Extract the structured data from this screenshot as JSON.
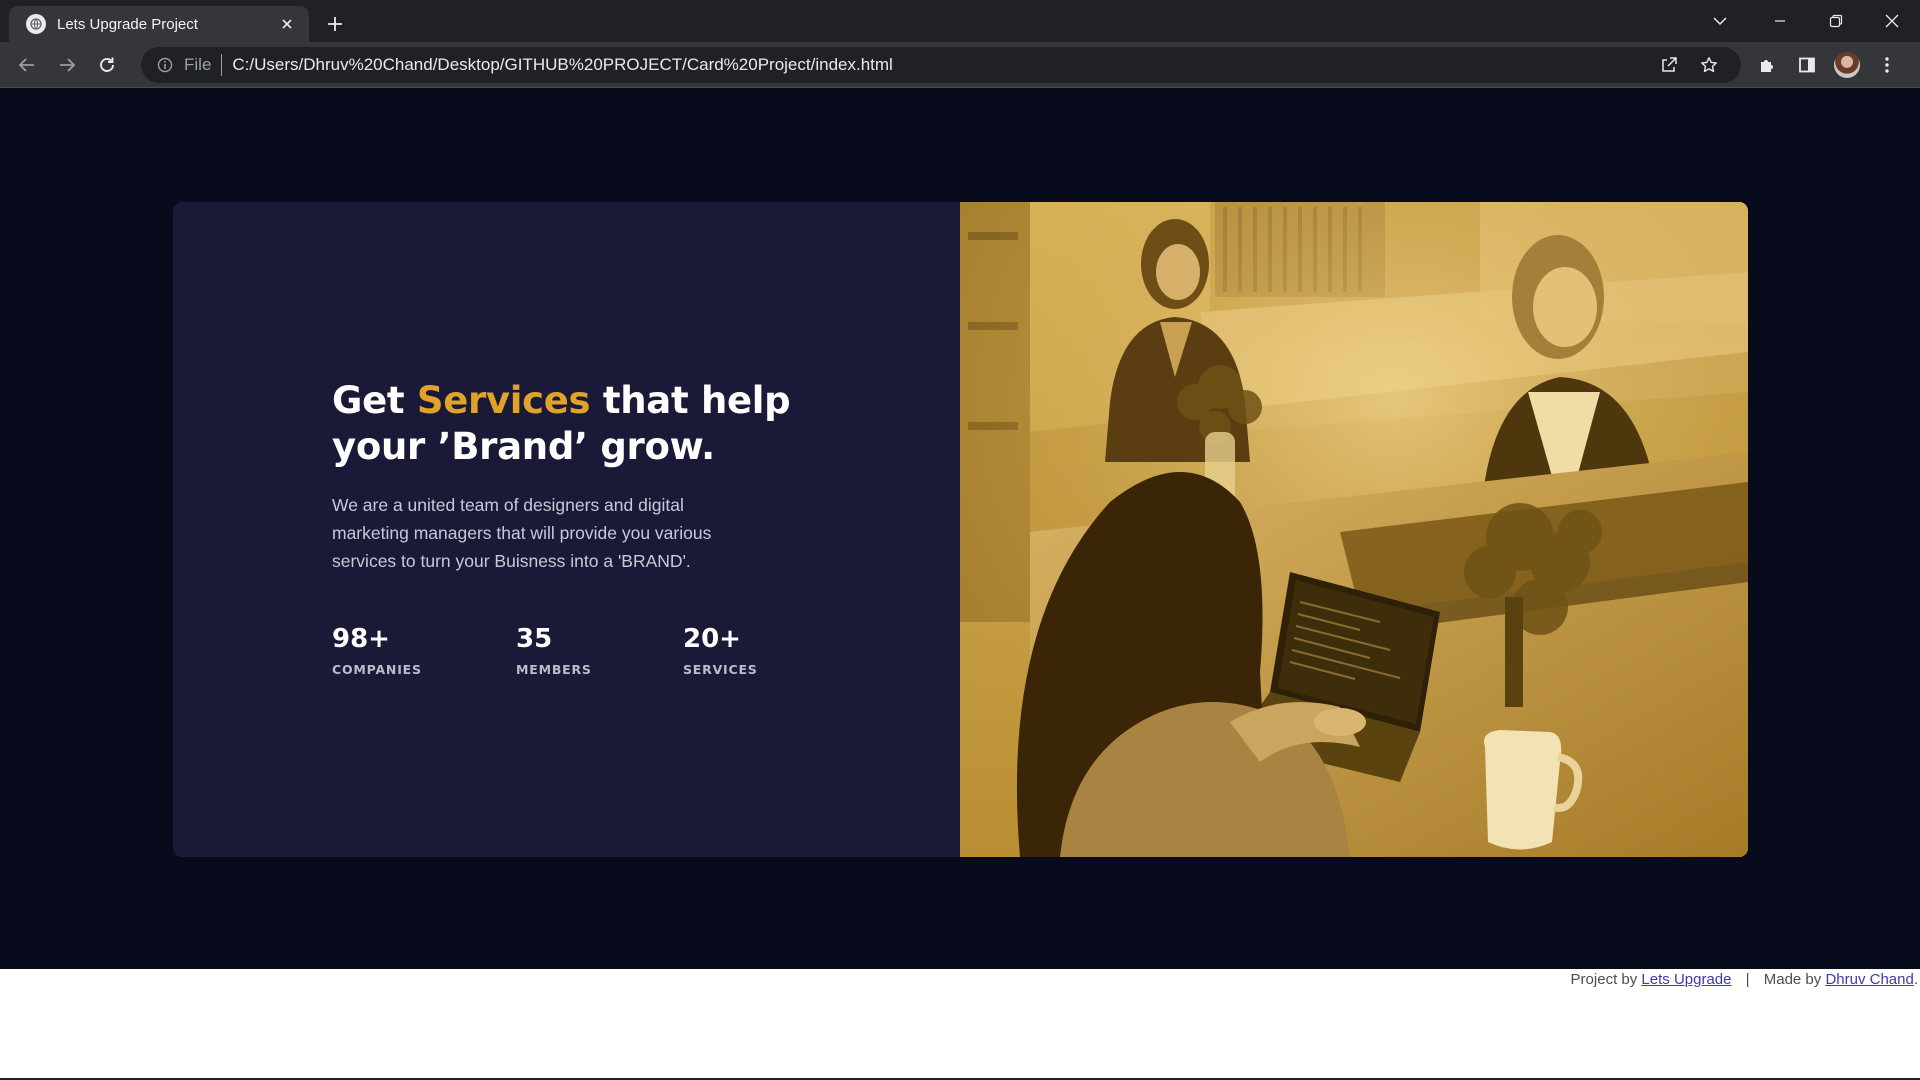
{
  "browser": {
    "tab_title": "Lets Upgrade Project",
    "address_label": "File",
    "url": "C:/Users/Dhruv%20Chand/Desktop/GITHUB%20PROJECT/Card%20Project/index.html"
  },
  "card": {
    "headline_pre": "Get ",
    "headline_accent": "Services",
    "headline_post": " that help your ’Brand’ grow.",
    "description": "We are a united team of designers and digital marketing managers that will provide you various services to turn your Buisness into a 'BRAND'.",
    "stats": [
      {
        "value": "98+",
        "label": "COMPANIES"
      },
      {
        "value": "35",
        "label": "MEMBERS"
      },
      {
        "value": "20+",
        "label": "SERVICES"
      }
    ],
    "accent_color": "#dfa32a",
    "card_background": "#1b1938",
    "page_background": "#080b1b",
    "image_tint": "#c89b39"
  },
  "footer": {
    "project_by_text": "Project by ",
    "project_by_link": "Lets Upgrade",
    "separator": "|",
    "made_by_text": "Made by ",
    "made_by_link": "Dhruv Chand",
    "end_punct": "."
  }
}
